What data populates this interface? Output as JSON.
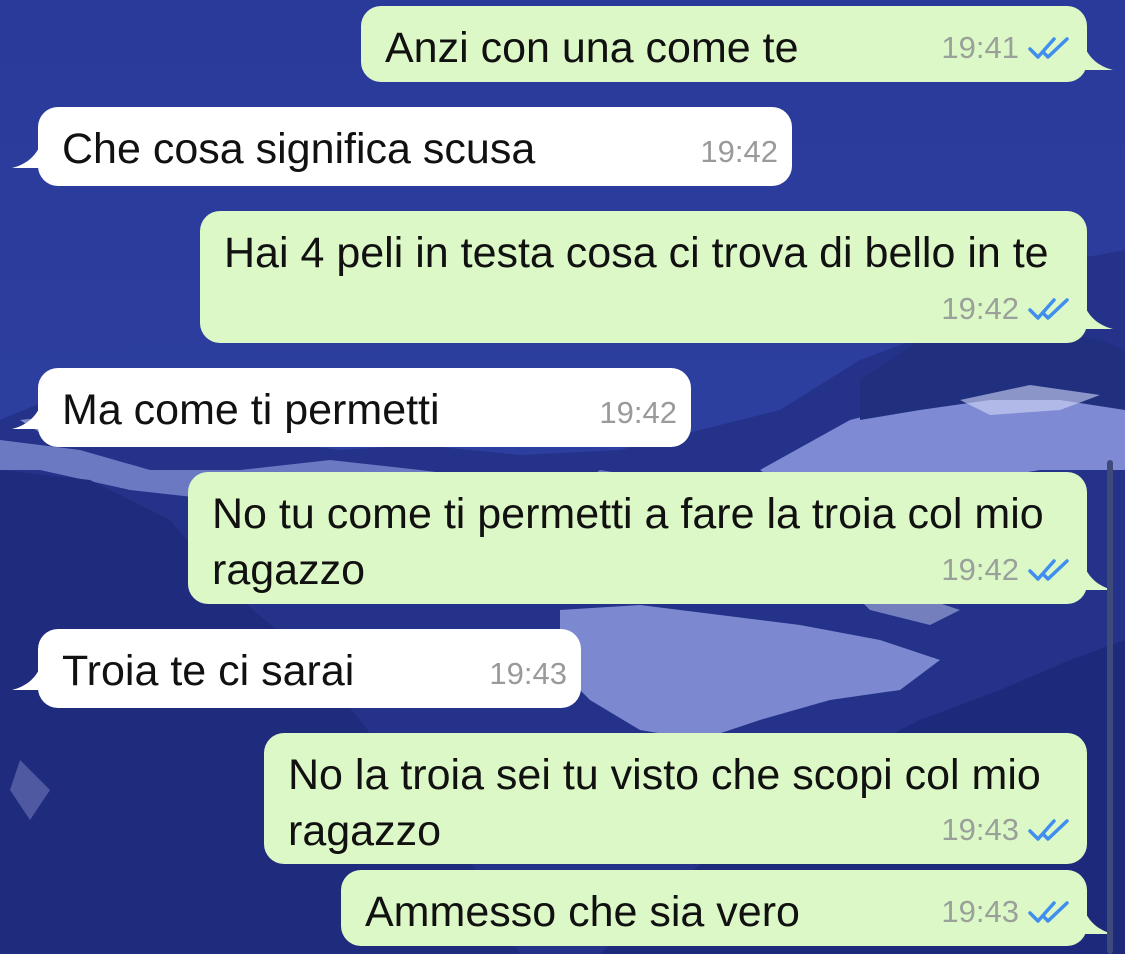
{
  "colors": {
    "outgoing_bubble": "#dcf8c6",
    "incoming_bubble": "#ffffff",
    "read_ticks": "#3f8ef0",
    "wallpaper": "#2c3f9c"
  },
  "messages": [
    {
      "direction": "out",
      "text": "Anzi con una come te",
      "time": "19:41",
      "status_icon": "double-check-read-icon"
    },
    {
      "direction": "in",
      "text": "Che cosa significa scusa",
      "time": "19:42"
    },
    {
      "direction": "out",
      "text": "Hai 4 peli in testa cosa ci trova di bello in te",
      "time": "19:42",
      "status_icon": "double-check-read-icon"
    },
    {
      "direction": "in",
      "text": "Ma come ti permetti",
      "time": "19:42"
    },
    {
      "direction": "out",
      "text": "No tu come ti permetti a fare la troia col mio ragazzo",
      "time": "19:42",
      "status_icon": "double-check-read-icon"
    },
    {
      "direction": "in",
      "text": "Troia te ci sarai",
      "time": "19:43"
    },
    {
      "direction": "out",
      "text": "No la troia sei tu visto che scopi col mio ragazzo",
      "time": "19:43",
      "status_icon": "double-check-read-icon"
    },
    {
      "direction": "out",
      "text": "Ammesso che sia vero",
      "time": "19:43",
      "status_icon": "double-check-read-icon"
    }
  ]
}
